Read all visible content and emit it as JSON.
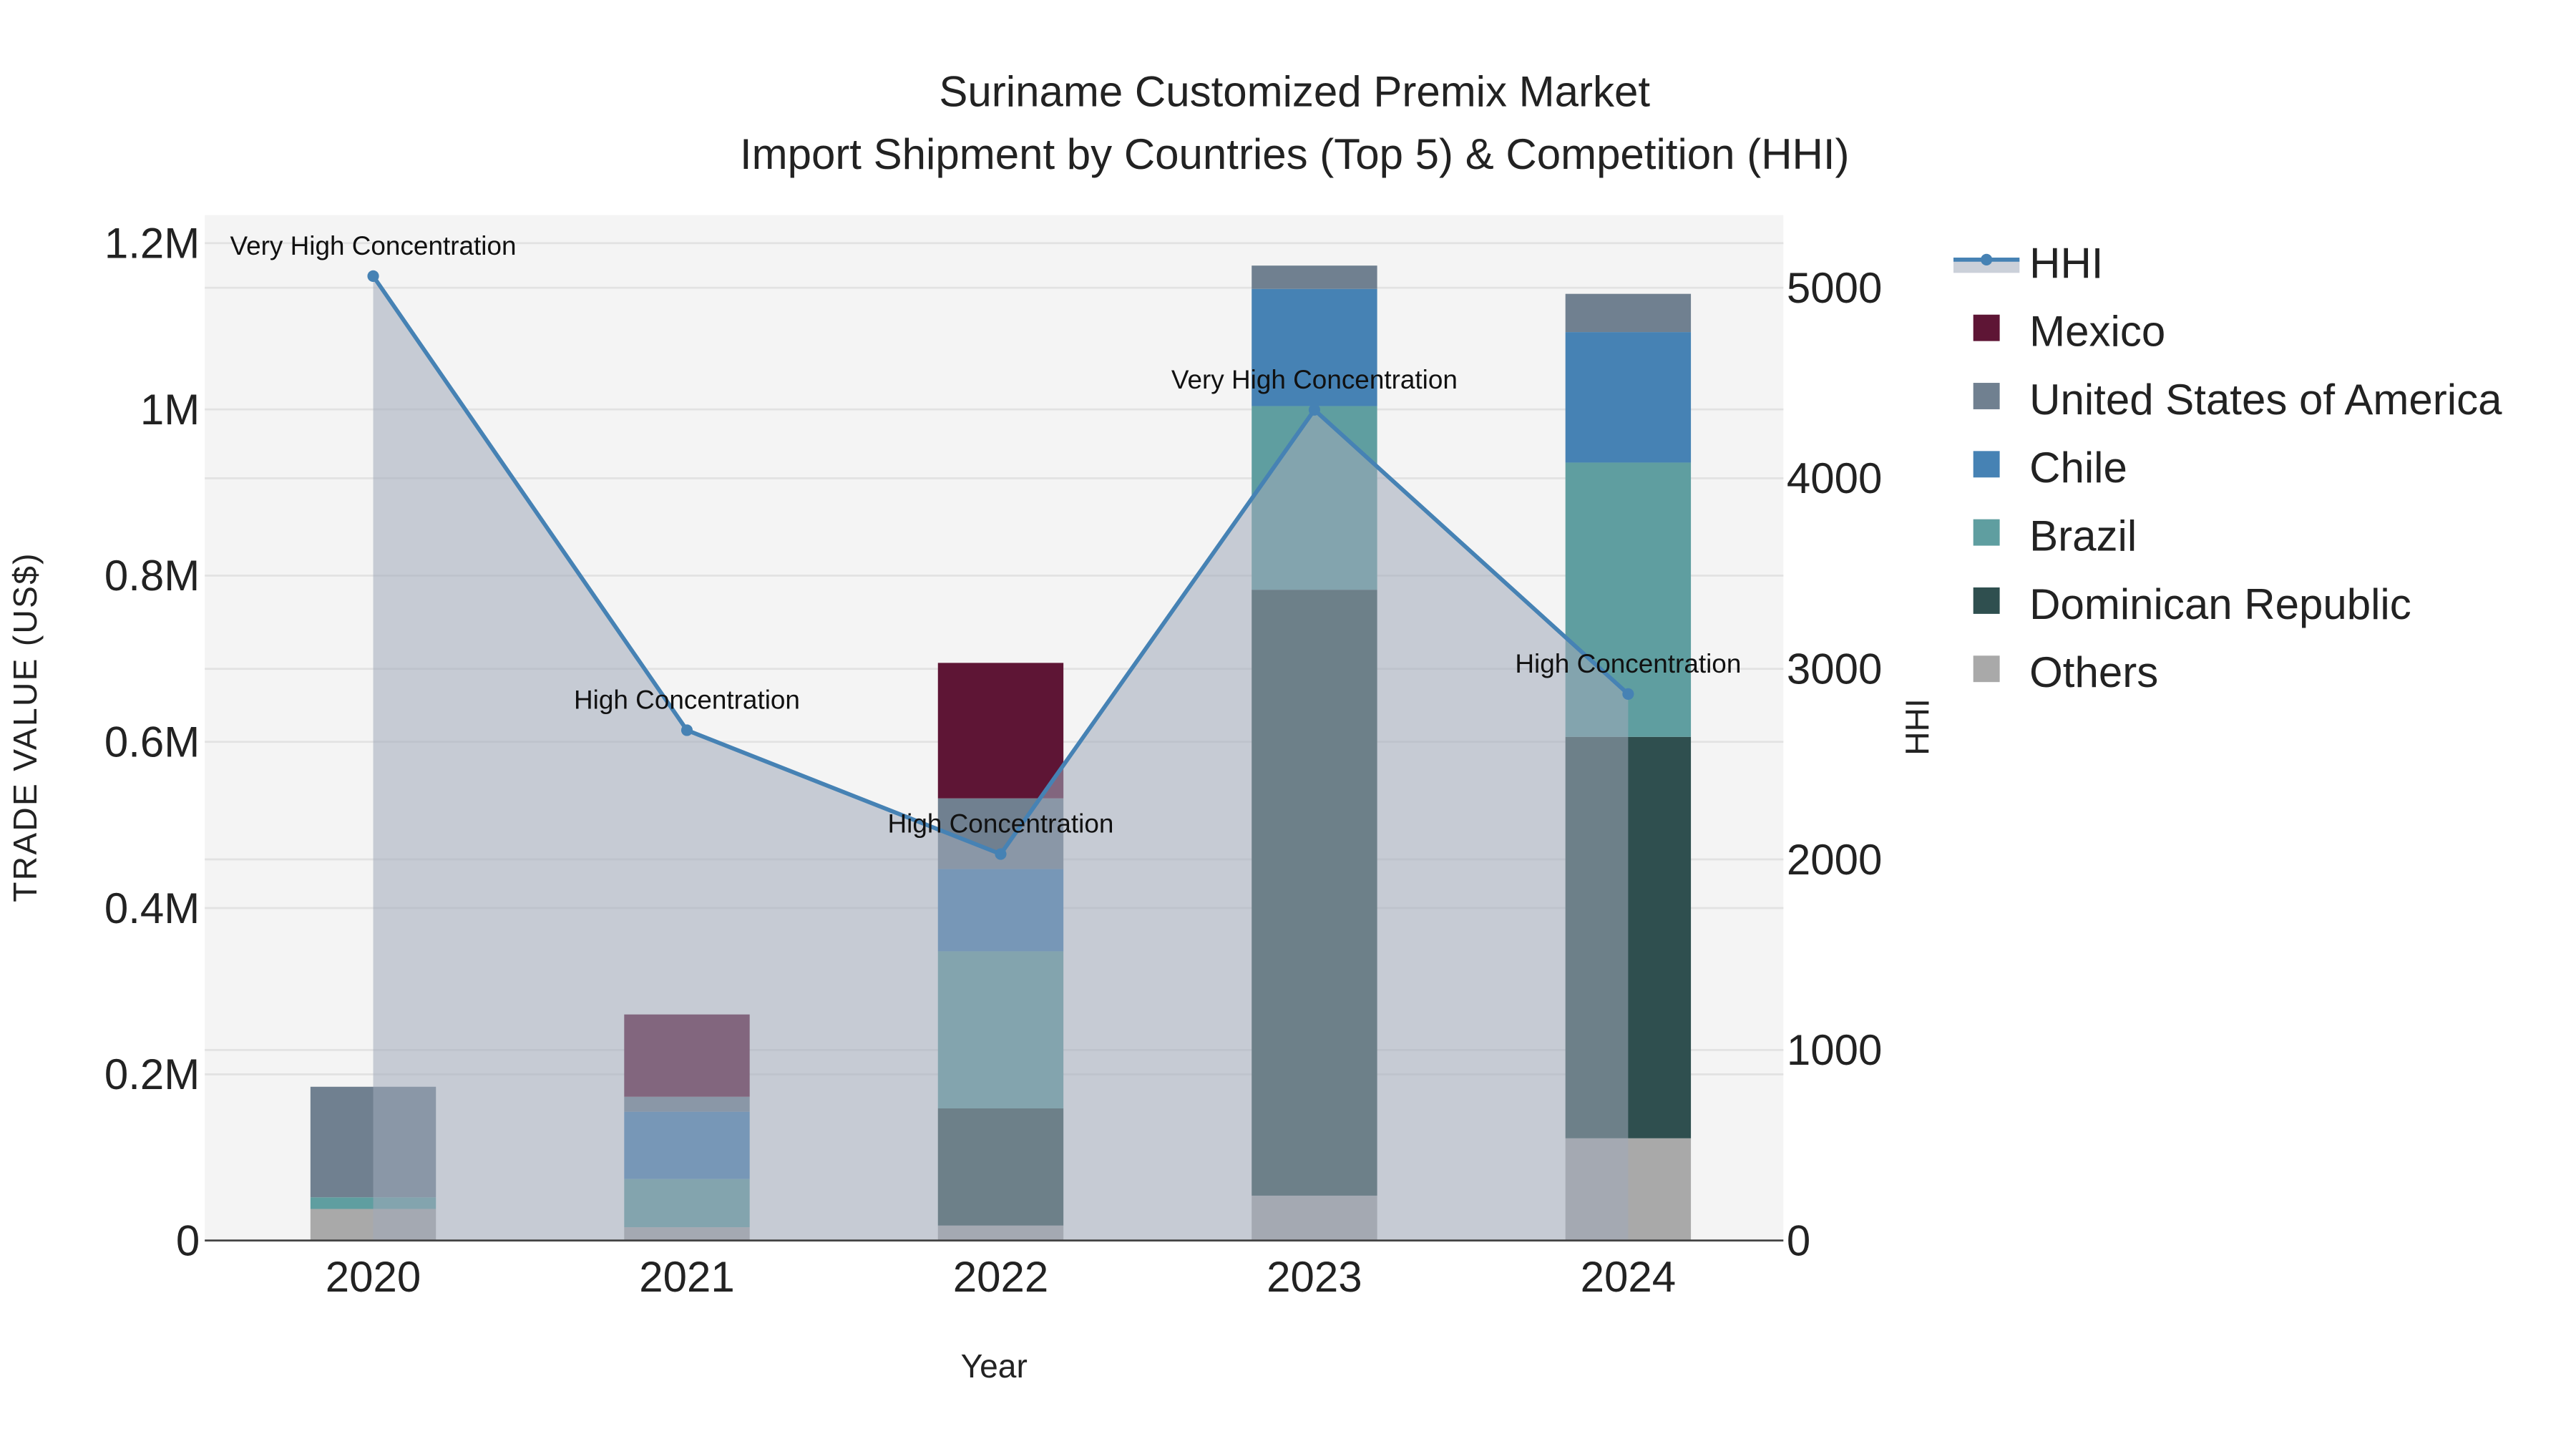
{
  "chart_data": {
    "type": "bar",
    "title": "Suriname Customized Premix Market",
    "subtitle": "Import Shipment by Countries (Top 5) & Competition (HHI)",
    "xlabel": "Year",
    "ylabel": "TRADE VALUE (US$)",
    "y2label": "HHI",
    "categories": [
      "2020",
      "2021",
      "2022",
      "2023",
      "2024"
    ],
    "ylim": [
      0,
      1.2
    ],
    "y_unit": "M US$",
    "yticks": [
      {
        "v": 0,
        "label": "0"
      },
      {
        "v": 0.2,
        "label": "0.2M"
      },
      {
        "v": 0.4,
        "label": "0.4M"
      },
      {
        "v": 0.6,
        "label": "0.6M"
      },
      {
        "v": 0.8,
        "label": "0.8M"
      },
      {
        "v": 1.0,
        "label": "1M"
      },
      {
        "v": 1.2,
        "label": "1.2M"
      }
    ],
    "y2lim": [
      0,
      5200
    ],
    "y2ticks": [
      {
        "v": 0,
        "label": "0"
      },
      {
        "v": 1000,
        "label": "1000"
      },
      {
        "v": 2000,
        "label": "2000"
      },
      {
        "v": 3000,
        "label": "3000"
      },
      {
        "v": 4000,
        "label": "4000"
      },
      {
        "v": 5000,
        "label": "5000"
      }
    ],
    "stacked": true,
    "grid": true,
    "legend_position": "right",
    "series": [
      {
        "name": "Others",
        "color": "#a9a9a9",
        "values": [
          0.038,
          0.016,
          0.018,
          0.054,
          0.123
        ]
      },
      {
        "name": "Dominican Republic",
        "color": "#2f4f4f",
        "values": [
          0,
          0,
          0.141,
          0.729,
          0.483
        ]
      },
      {
        "name": "Brazil",
        "color": "#5f9ea0",
        "values": [
          0.014,
          0.058,
          0.189,
          0.221,
          0.33
        ]
      },
      {
        "name": "Chile",
        "color": "#4682b4",
        "values": [
          0,
          0.081,
          0.099,
          0.141,
          0.157
        ]
      },
      {
        "name": "United States of America",
        "color": "#708090",
        "values": [
          0.133,
          0.018,
          0.085,
          0.028,
          0.046
        ]
      },
      {
        "name": "Mexico",
        "color": "#5e1535",
        "values": [
          0,
          0.099,
          0.163,
          0,
          0
        ]
      }
    ],
    "hhi": {
      "name": "HHI",
      "color": "#4682b4",
      "values": [
        5061,
        2678,
        2028,
        4359,
        2868
      ],
      "annotations": [
        "Very High Concentration",
        "High Concentration",
        "High Concentration",
        "Very High Concentration",
        "High Concentration"
      ]
    },
    "legend_order": [
      "HHI",
      "Mexico",
      "United States of America",
      "Chile",
      "Brazil",
      "Dominican Republic",
      "Others"
    ]
  }
}
